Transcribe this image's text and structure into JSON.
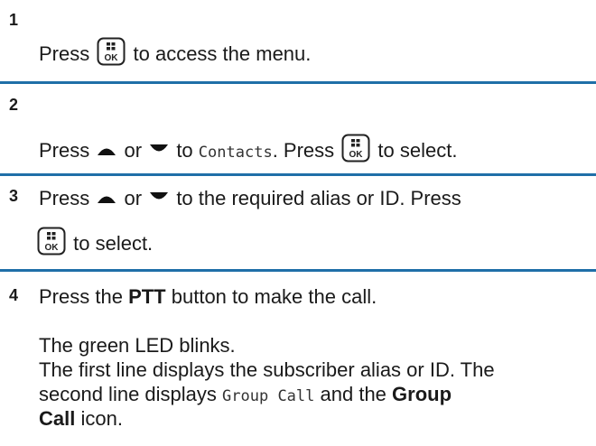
{
  "steps": [
    {
      "number": "1",
      "parts": {
        "press": "Press",
        "rest": "to access the menu."
      }
    },
    {
      "number": "2",
      "parts": {
        "press": "Press",
        "or": "or",
        "to": "to",
        "mono": "Contacts",
        "dot_press": ". Press",
        "rest": "to select."
      }
    },
    {
      "number": "3",
      "parts": {
        "press": "Press",
        "or": "or",
        "rest1": "to the required alias or ID. Press",
        "rest2": "to select."
      }
    },
    {
      "number": "4",
      "parts": {
        "press": "Press the",
        "ptt": "PTT",
        "rest": "button to make the call.",
        "led": "The green LED blinks.",
        "line1": "The first line displays the subscriber alias or ID. The",
        "line2a": "second line displays",
        "line2mono": "Group Call",
        "line2b": "and the",
        "line2bold": "Group",
        "line3bold": "Call",
        "line3rest": "icon."
      }
    }
  ],
  "colors": {
    "divider": "#1f6fa8",
    "text": "#1a1a1a"
  },
  "icons": {
    "menu_ok_key": "menu-ok-button-icon",
    "up": "up-arrow-icon",
    "down": "down-arrow-icon"
  }
}
